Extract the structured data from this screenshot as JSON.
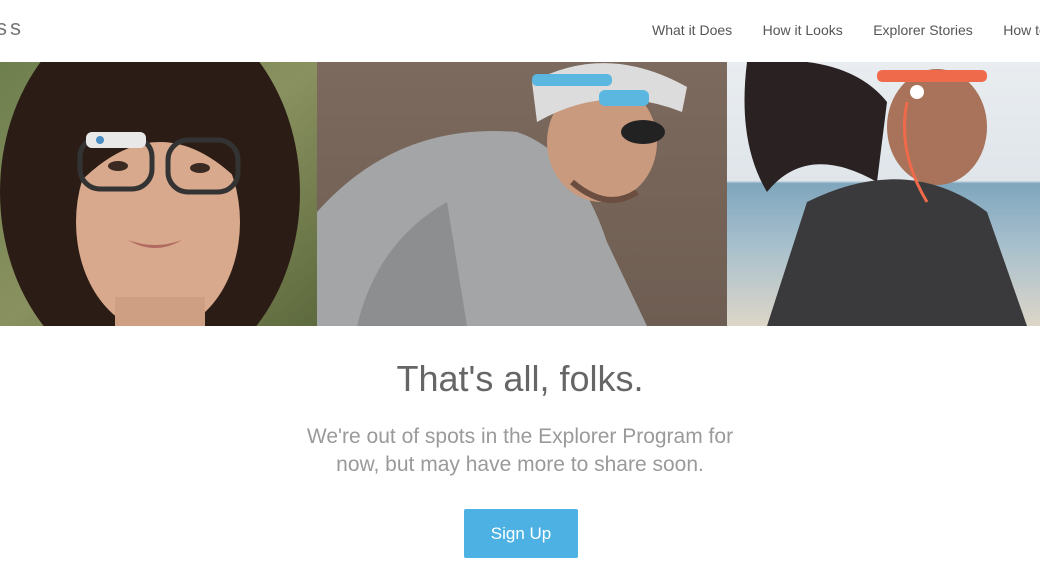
{
  "header": {
    "logo_text": "ss",
    "nav": [
      {
        "label": "What it Does"
      },
      {
        "label": "How it Looks"
      },
      {
        "label": "Explorer Stories"
      },
      {
        "label": "How to G"
      }
    ]
  },
  "hero": {
    "panels": [
      {
        "alt": "woman-wearing-glass-frames"
      },
      {
        "alt": "cyclist-wearing-glass"
      },
      {
        "alt": "runner-wearing-glass"
      }
    ]
  },
  "main": {
    "headline": "That's all, folks.",
    "subtext_line1": "We're out of spots in the Explorer Program for",
    "subtext_line2": "now, but may have more to share soon.",
    "signup_label": "Sign Up"
  },
  "colors": {
    "accent": "#4db2e3",
    "headline": "#666666",
    "subtext": "#9a9a9a"
  }
}
